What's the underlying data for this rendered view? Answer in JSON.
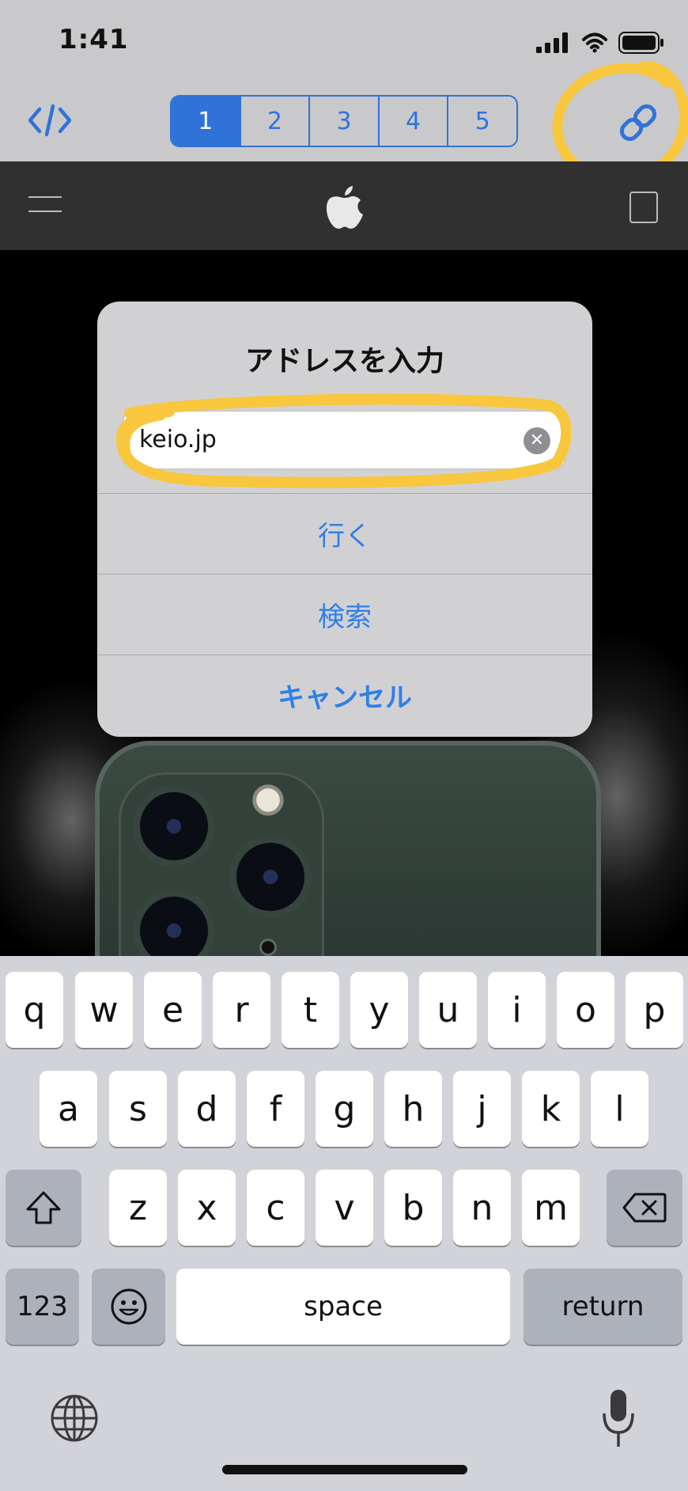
{
  "status_bar": {
    "time": "1:41"
  },
  "toolbar": {
    "tabs": [
      {
        "label": "1",
        "active": true
      },
      {
        "label": "2",
        "active": false
      },
      {
        "label": "3",
        "active": false
      },
      {
        "label": "4",
        "active": false
      },
      {
        "label": "5",
        "active": false
      }
    ],
    "accent_color": "#2f73d9",
    "icons": [
      "code-icon",
      "link-icon"
    ]
  },
  "webpage": {
    "nav_icons": [
      "menu-icon",
      "apple-logo",
      "bag-icon"
    ]
  },
  "alert": {
    "title": "アドレスを入力",
    "input_value": "keio.jp",
    "actions": [
      "行く",
      "検索",
      "キャンセル"
    ],
    "action_color": "#2f7fe8"
  },
  "keyboard": {
    "row1": [
      "q",
      "w",
      "e",
      "r",
      "t",
      "y",
      "u",
      "i",
      "o",
      "p"
    ],
    "row2": [
      "a",
      "s",
      "d",
      "f",
      "g",
      "h",
      "j",
      "k",
      "l"
    ],
    "row3": [
      "z",
      "x",
      "c",
      "v",
      "b",
      "n",
      "m"
    ],
    "numbers_label": "123",
    "space_label": "space",
    "return_label": "return"
  },
  "annotation_color": "#f8c73e"
}
